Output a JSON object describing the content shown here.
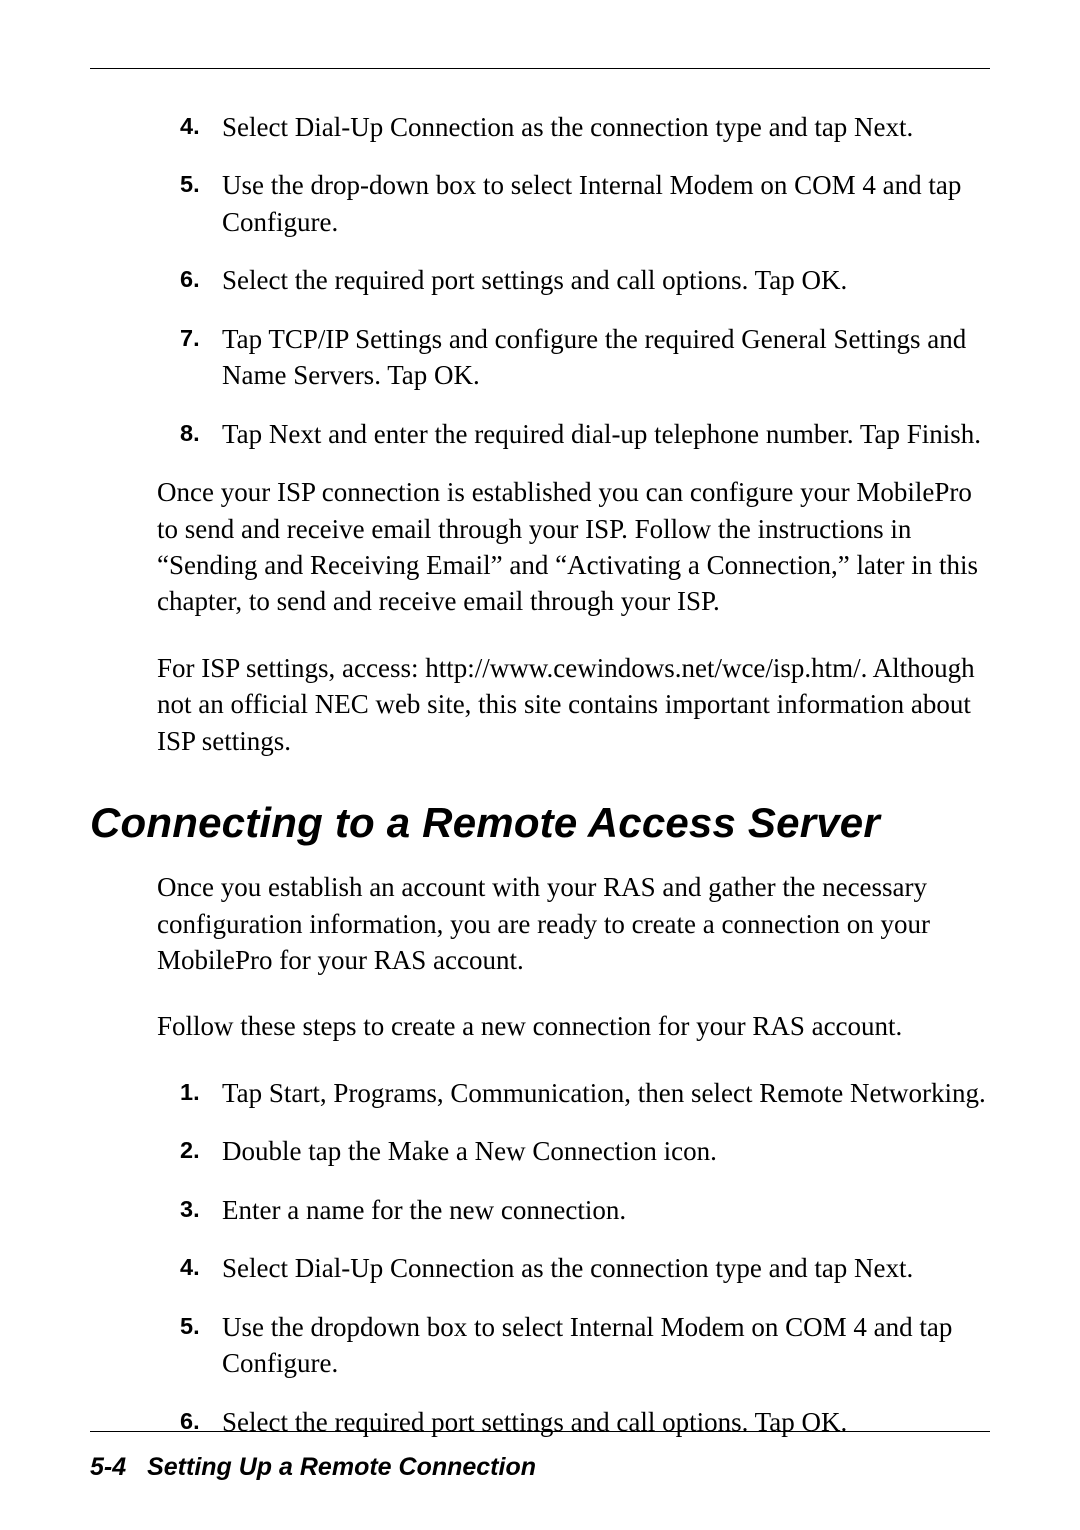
{
  "listA": {
    "items": [
      {
        "num": "4.",
        "text": "Select Dial-Up Connection as the connection type and tap Next."
      },
      {
        "num": "5.",
        "text": "Use the drop-down box to select Internal Modem on COM 4 and tap Configure."
      },
      {
        "num": "6.",
        "text": "Select the required port settings and call options. Tap OK."
      },
      {
        "num": "7.",
        "text": "Tap TCP/IP Settings and configure the required General Settings and Name Servers. Tap OK."
      },
      {
        "num": "8.",
        "text": "Tap Next and enter the required dial-up telephone number. Tap Finish."
      }
    ]
  },
  "para1": "Once your ISP connection is established you can configure your MobilePro to send and receive email through your ISP. Follow the instructions in “Sending and Receiving Email” and “Activating a Connection,” later in this chapter, to send and receive email through your ISP.",
  "para2": "For ISP settings, access: http://www.cewindows.net/wce/isp.htm/. Although not an official NEC web site, this site contains important information about ISP settings.",
  "heading": "Connecting to a Remote Access Server",
  "para3": "Once you establish an account with your RAS and gather the necessary configuration information, you are ready to create a connection on your MobilePro for your RAS account.",
  "para4": "Follow these steps to create a new connection for your RAS account.",
  "listB": {
    "items": [
      {
        "num": "1.",
        "text": "Tap Start, Programs, Communication, then select Remote Networking."
      },
      {
        "num": "2.",
        "text": "Double tap the Make a New Connection icon."
      },
      {
        "num": "3.",
        "text": "Enter a name for the new connection."
      },
      {
        "num": "4.",
        "text": "Select Dial-Up Connection as the connection type and tap Next."
      },
      {
        "num": "5.",
        "text": "Use the dropdown box to select Internal Modem on COM 4 and tap Configure."
      },
      {
        "num": "6.",
        "text": "Select the required port settings and call options. Tap OK."
      }
    ]
  },
  "footer": {
    "page": "5-4",
    "title": "Setting Up a Remote Connection"
  }
}
